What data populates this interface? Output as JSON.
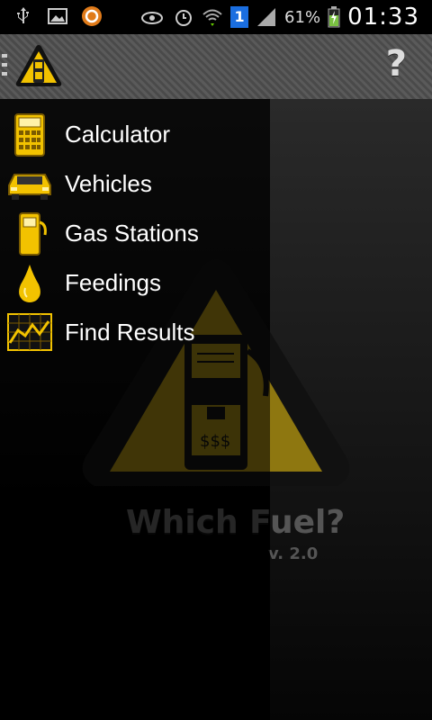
{
  "status_bar": {
    "battery_percent": "61%",
    "time": "01:33",
    "notification_count": "1"
  },
  "action_bar": {
    "help_label": "?"
  },
  "menu": {
    "items": [
      {
        "label": "Calculator",
        "icon": "calculator-icon"
      },
      {
        "label": "Vehicles",
        "icon": "car-icon"
      },
      {
        "label": "Gas Stations",
        "icon": "fuel-pump-icon"
      },
      {
        "label": "Feedings",
        "icon": "fuel-drop-icon"
      },
      {
        "label": "Find Results",
        "icon": "chart-icon"
      }
    ]
  },
  "splash": {
    "app_name": "Which Fuel?",
    "version": "v. 2.0",
    "price_sign": "$$$"
  },
  "colors": {
    "accent": "#f2c200",
    "menu_text": "#ffffff"
  }
}
